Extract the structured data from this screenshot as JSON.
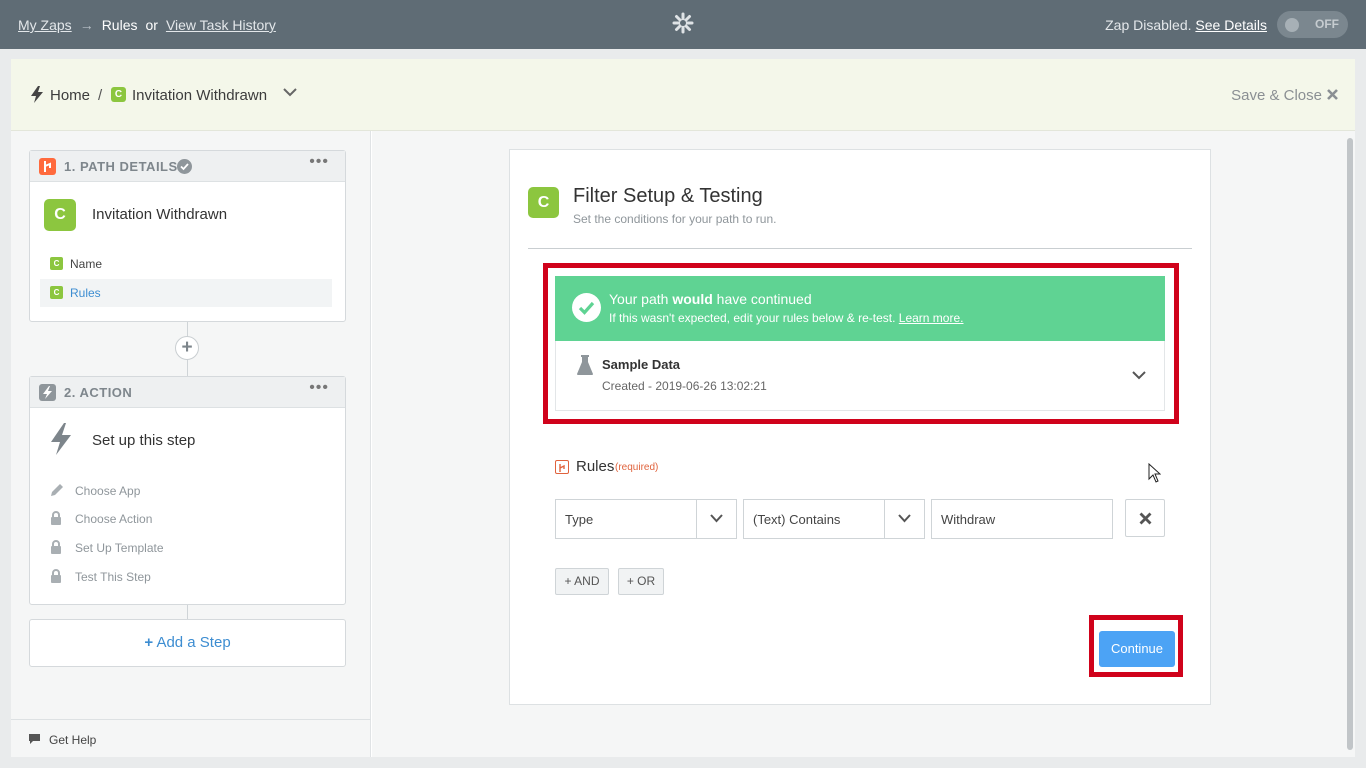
{
  "topbar": {
    "breadcrumbs": [
      "My Zaps",
      "Rules",
      "or",
      "View Task History"
    ],
    "arrow": "→",
    "status_text": "Zap Disabled.",
    "status_link": "See Details",
    "toggle_label": "OFF"
  },
  "header": {
    "home": "Home",
    "slash": "/",
    "app_badge": "C",
    "zap_name": "Invitation Withdrawn",
    "save_close": "Save & Close"
  },
  "sidebar": {
    "step1": {
      "header": "1. PATH DETAILS",
      "badge": "C",
      "title": "Invitation Withdrawn",
      "items": [
        {
          "badge": "C",
          "label": "Name"
        },
        {
          "badge": "C",
          "label": "Rules"
        }
      ]
    },
    "step2": {
      "header": "2. ACTION",
      "title": "Set up this step",
      "items": [
        "Choose App",
        "Choose Action",
        "Set Up Template",
        "Test This Step"
      ]
    },
    "add_step": "Add a Step",
    "add_step_plus": "+",
    "get_help": "Get Help",
    "dots": "•••"
  },
  "panel": {
    "badge": "C",
    "title": "Filter Setup & Testing",
    "subtitle": "Set the conditions for your path to run.",
    "success": {
      "heading_pre": "Your path ",
      "heading_bold": "would",
      "heading_post": " have continued",
      "text": "If this wasn't expected, edit your rules below & re-test.",
      "link": "Learn more."
    },
    "sample": {
      "title": "Sample Data",
      "created": "Created - 2019-06-26 13:02:21"
    },
    "rules": {
      "label": "Rules",
      "required": "(required)",
      "field": "Type",
      "condition": "(Text) Contains",
      "value": "Withdraw",
      "and_label": "+ AND",
      "or_label": "+ OR"
    },
    "continue_label": "Continue"
  },
  "colors": {
    "topbar": "#5f6c75",
    "brand_green": "#8cc63f",
    "success_green": "#5fd393",
    "highlight_red": "#d0021b",
    "button_blue": "#4ca3f5",
    "path_orange": "#ff6a3d"
  }
}
